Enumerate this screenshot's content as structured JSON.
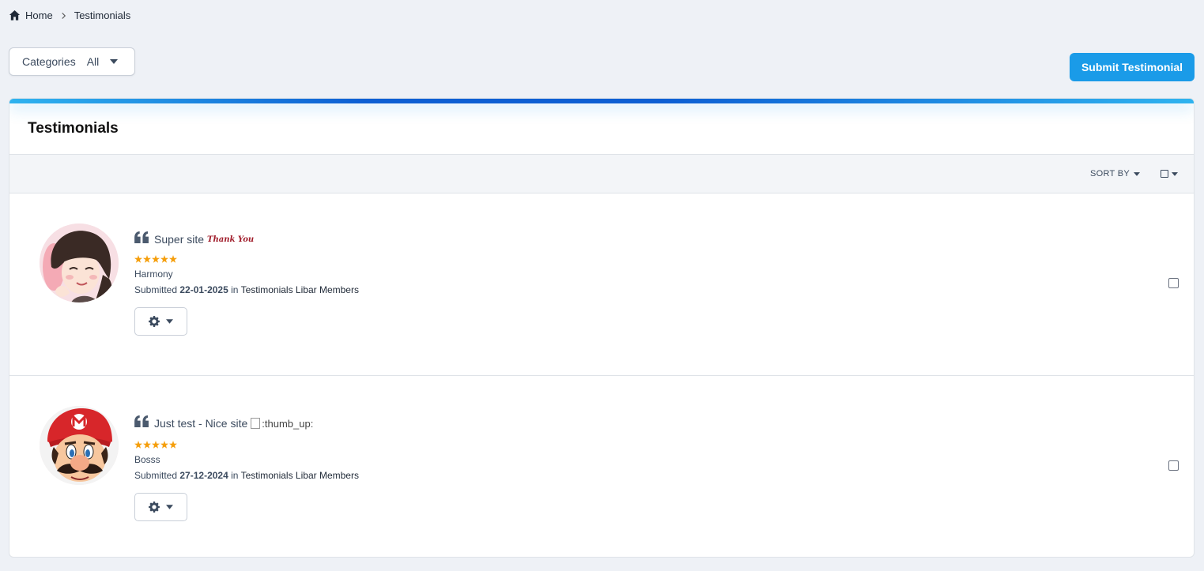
{
  "breadcrumb": {
    "home": "Home",
    "current": "Testimonials"
  },
  "categories": {
    "label": "Categories",
    "value": "All"
  },
  "submit_button": "Submit Testimonial",
  "panel": {
    "title": "Testimonials",
    "sort_label": "SORT BY"
  },
  "testimonials": [
    {
      "text": "Super site",
      "emoji_text": "Thank You",
      "rating": 5,
      "author": "Harmony",
      "submitted_prefix": "Submitted",
      "date": "22-01-2025",
      "in_word": "in",
      "category": "Testimonials Libar Members"
    },
    {
      "text": "Just test - Nice site",
      "emoji_alt": ":thumb_up:",
      "rating": 5,
      "author": "Bosss",
      "submitted_prefix": "Submitted",
      "date": "27-12-2024",
      "in_word": "in",
      "category": "Testimonials Libar Members"
    }
  ],
  "colors": {
    "accent": "#1a9be8",
    "star": "#f59e0b",
    "text": "#3b4a5e"
  }
}
